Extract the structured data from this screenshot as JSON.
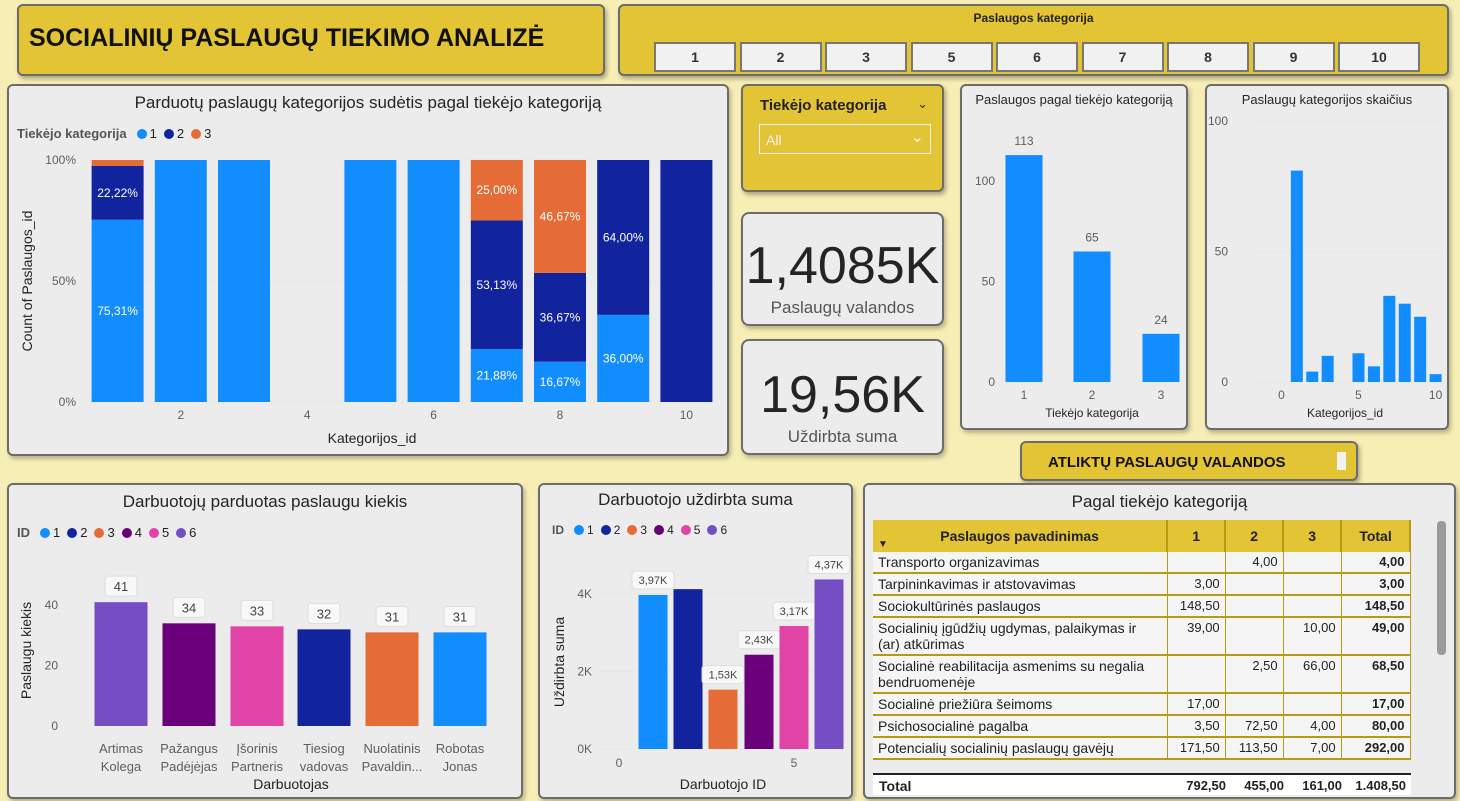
{
  "header": {
    "title": "SOCIALINIŲ PASLAUGŲ TIEKIMO ANALIZĖ",
    "category_slicer_title": "Paslaugos kategorija",
    "category_buttons": [
      "1",
      "2",
      "3",
      "5",
      "6",
      "7",
      "8",
      "9",
      "10"
    ]
  },
  "composition_chart": {
    "title": "Parduotų paslaugų kategorijos sudėtis pagal tiekėjo kategoriją",
    "legend_title": "Tiekėjo kategorija",
    "legend": [
      "1",
      "2",
      "3"
    ],
    "chart_data": {
      "type": "bar",
      "stacked": "100%",
      "xlabel": "Kategorijos_id",
      "ylabel": "Count of Paslaugos_id",
      "x_ticks": [
        "2",
        "4",
        "6",
        "8",
        "10"
      ],
      "y_ticks": [
        "0%",
        "50%",
        "100%"
      ],
      "categories": [
        1,
        2,
        3,
        5,
        6,
        7,
        8,
        9,
        10
      ],
      "series": [
        {
          "name": "1",
          "values": [
            75.31,
            100,
            100,
            100,
            100,
            21.88,
            16.67,
            36.0,
            0
          ]
        },
        {
          "name": "2",
          "values": [
            22.22,
            0,
            0,
            0,
            0,
            53.13,
            36.67,
            64.0,
            100
          ]
        },
        {
          "name": "3",
          "values": [
            2.47,
            0,
            0,
            0,
            0,
            25.0,
            46.67,
            0,
            0
          ]
        }
      ],
      "data_labels": [
        "22,22%",
        "75,31%",
        "25,00%",
        "53,13%",
        "21,88%",
        "46,67%",
        "36,67%",
        "16,67%",
        "64,00%",
        "36,00%"
      ]
    }
  },
  "supplier_slicer": {
    "title": "Tiekėjo kategorija",
    "value": "All"
  },
  "kpis": {
    "hours_value": "1,4085K",
    "hours_label": "Paslaugų valandos",
    "earned_value": "19,56K",
    "earned_label": "Uždirbta suma"
  },
  "supplier_chart": {
    "title": "Paslaugos pagal tiekėjo kategoriją",
    "chart_data": {
      "type": "bar",
      "xlabel": "Tiekėjo kategorija",
      "categories": [
        "1",
        "2",
        "3"
      ],
      "values": [
        113,
        65,
        24
      ],
      "y_ticks": [
        "0",
        "50",
        "100"
      ],
      "ylim": [
        0,
        125
      ]
    }
  },
  "count_chart": {
    "title": "Paslaugų kategorijos skaičius",
    "chart_data": {
      "type": "bar",
      "xlabel": "Kategorijos_id",
      "x_ticks": [
        "0",
        "5",
        "10"
      ],
      "y_ticks": [
        "0",
        "50",
        "100"
      ],
      "ylim": [
        0,
        100
      ],
      "categories": [
        1,
        2,
        3,
        5,
        6,
        7,
        8,
        9,
        10
      ],
      "values": [
        81,
        4,
        10,
        11,
        6,
        33,
        30,
        25,
        3
      ]
    }
  },
  "hours_button": {
    "label": "ATLIKTŲ PASLAUGŲ VALANDOS"
  },
  "employees_chart": {
    "title": "Darbuotojų parduotas paslaugu kiekis",
    "legend_title": "ID",
    "legend": [
      "1",
      "2",
      "3",
      "4",
      "5",
      "6"
    ],
    "chart_data": {
      "type": "bar",
      "xlabel": "Darbuotojas",
      "ylabel": "Paslaugu kiekis",
      "y_ticks": [
        "0",
        "20",
        "40"
      ],
      "ylim": [
        0,
        50
      ],
      "categories": [
        "Artimas Kolega",
        "Pažangus Padėjėjas",
        "Įšorinis Partneris",
        "Tiesiog vadovas",
        "Nuolatinis Pavaldin...",
        "Robotas Jonas"
      ],
      "category_lines": [
        [
          "Artimas",
          "Kolega"
        ],
        [
          "Pažangus",
          "Padėjėjas"
        ],
        [
          "Įšorinis",
          "Partneris"
        ],
        [
          "Tiesiog",
          "vadovas"
        ],
        [
          "Nuolatinis",
          "Pavaldin..."
        ],
        [
          "Robotas",
          "Jonas"
        ]
      ],
      "values": [
        41,
        34,
        33,
        32,
        31,
        31
      ],
      "labels": [
        "41",
        "34",
        "33",
        "32",
        "31",
        "31"
      ],
      "colors": [
        "#744ec2",
        "#6b007b",
        "#e044a7",
        "#12239e",
        "#e66c37",
        "#118dff"
      ]
    }
  },
  "earnings_chart": {
    "title": "Darbuotojo uždirbta suma",
    "legend_title": "ID",
    "legend": [
      "1",
      "2",
      "3",
      "4",
      "5",
      "6"
    ],
    "chart_data": {
      "type": "bar",
      "xlabel": "Darbuotojo ID",
      "ylabel": "Uždirbta suma",
      "x_ticks": [
        "0",
        "5"
      ],
      "y_ticks": [
        "0K",
        "2K",
        "4K"
      ],
      "ylim": [
        0,
        5000
      ],
      "categories": [
        1,
        2,
        3,
        4,
        5,
        6
      ],
      "values": [
        3970,
        4120,
        1530,
        2430,
        3170,
        4370
      ],
      "labels": [
        "3,97K",
        "",
        "1,53K",
        "2,43K",
        "3,17K",
        "4,37K"
      ],
      "colors": [
        "#118dff",
        "#12239e",
        "#e66c37",
        "#6b007b",
        "#e044a7",
        "#744ec2"
      ]
    }
  },
  "matrix": {
    "title": "Pagal tiekėjo kategoriją",
    "headers": [
      "Paslaugos pavadinimas",
      "1",
      "2",
      "3",
      "Total"
    ],
    "rows": [
      {
        "name": "Transporto organizavimas",
        "c1": "",
        "c2": "4,00",
        "c3": "",
        "total": "4,00"
      },
      {
        "name": "Tarpininkavimas ir atstovavimas",
        "c1": "3,00",
        "c2": "",
        "c3": "",
        "total": "3,00"
      },
      {
        "name": "Sociokultūrinės paslaugos",
        "c1": "148,50",
        "c2": "",
        "c3": "",
        "total": "148,50"
      },
      {
        "name": "Socialinių įgūdžių ugdymas, palaikymas ir (ar) atkūrimas",
        "c1": "39,00",
        "c2": "",
        "c3": "10,00",
        "total": "49,00"
      },
      {
        "name": "Socialinė reabilitacija asmenims su negalia bendruomenėje",
        "c1": "",
        "c2": "2,50",
        "c3": "66,00",
        "total": "68,50"
      },
      {
        "name": "Socialinė priežiūra šeimoms",
        "c1": "17,00",
        "c2": "",
        "c3": "",
        "total": "17,00"
      },
      {
        "name": "Psichosocialinė pagalba",
        "c1": "3,50",
        "c2": "72,50",
        "c3": "4,00",
        "total": "80,00"
      },
      {
        "name": "Potencialių socialinių paslaugų gavėjų",
        "c1": "171,50",
        "c2": "113,50",
        "c3": "7,00",
        "total": "292,00"
      }
    ],
    "total": {
      "name": "Total",
      "c1": "792,50",
      "c2": "455,00",
      "c3": "161,00",
      "total": "1.408,50"
    }
  },
  "colors": {
    "series1": "#118dff",
    "series2": "#12239e",
    "series3": "#e66c37",
    "gold": "#e3c434",
    "background": "#f7eeb5"
  }
}
